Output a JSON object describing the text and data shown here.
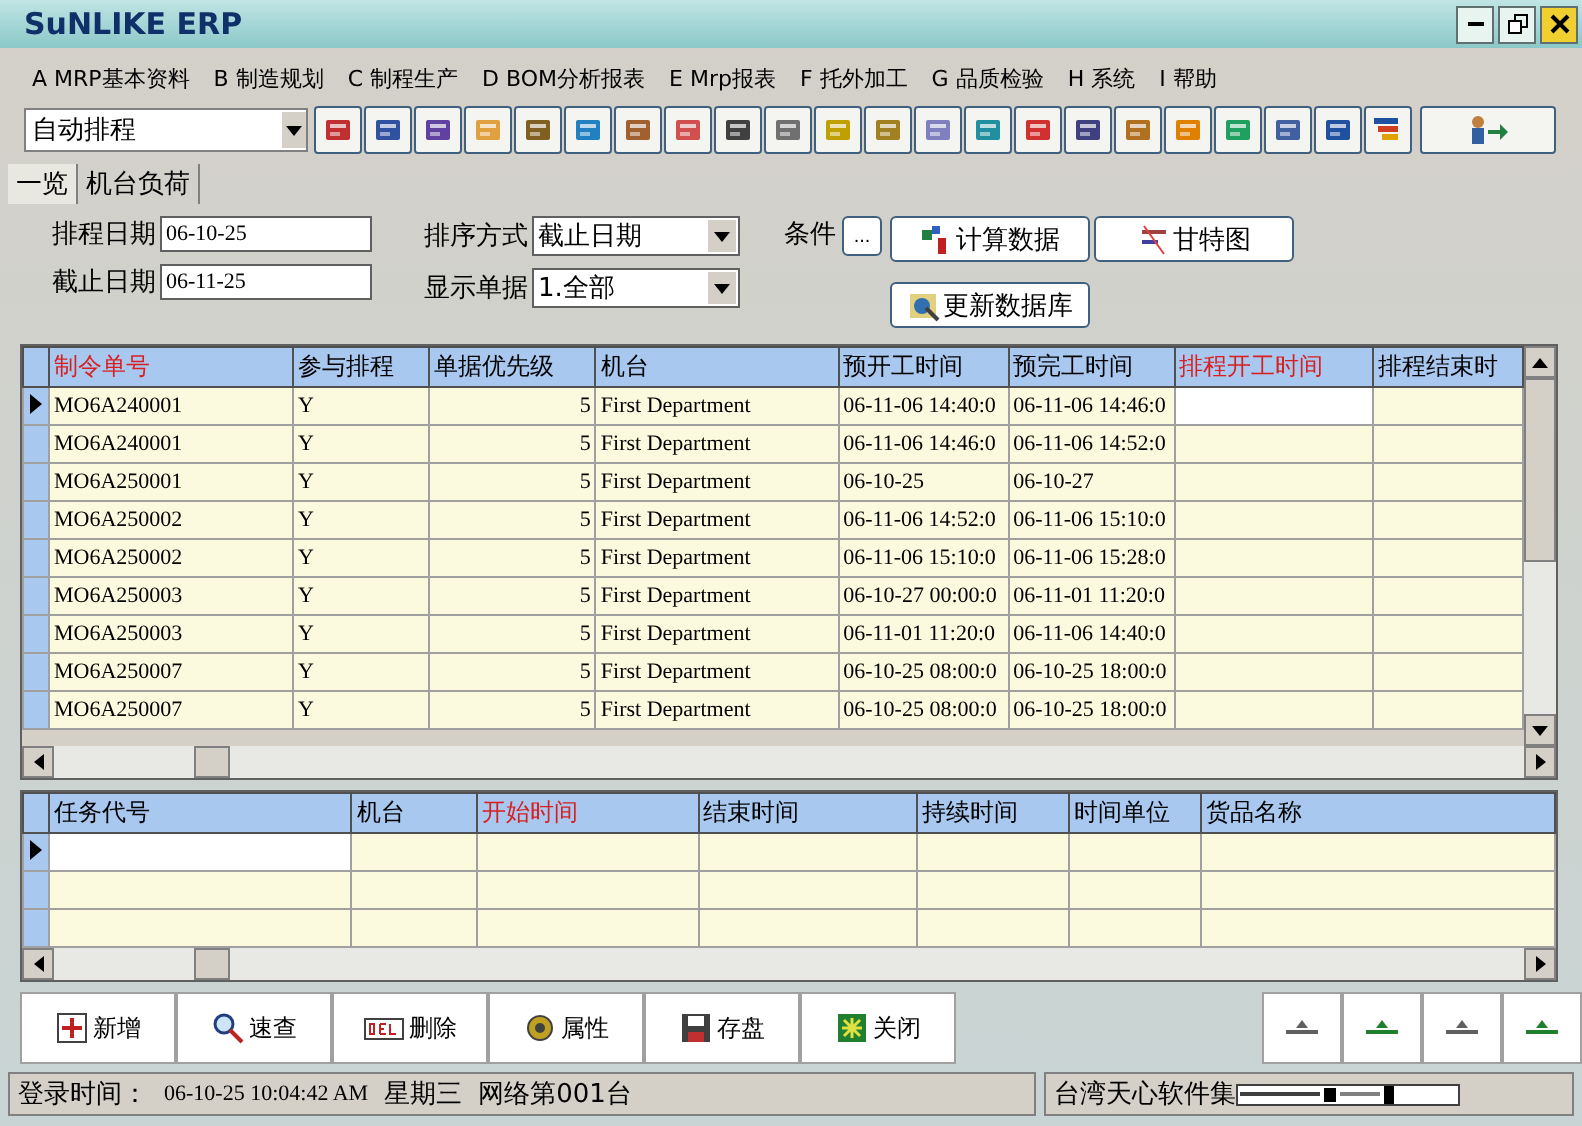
{
  "window": {
    "title": "SuNLIKE ERP"
  },
  "menu": [
    "A MRP基本资料",
    "B 制造规划",
    "C 制程生产",
    "D BOM分析报表",
    "E Mrp报表",
    "F 托外加工",
    "G 品质检验",
    "H 系统",
    "I 帮助"
  ],
  "toolbar": {
    "combo": "自动排程"
  },
  "tabs": [
    {
      "label": "一览",
      "selected": true
    },
    {
      "label": "机台负荷",
      "selected": false
    }
  ],
  "form": {
    "fields": [
      {
        "label": "排程日期",
        "value": "06-10-25"
      },
      {
        "label": "截止日期",
        "value": "06-11-25"
      }
    ],
    "selects": [
      {
        "label": "排序方式",
        "value": "截止日期"
      },
      {
        "label": "显示单据",
        "value": "1.全部"
      }
    ],
    "condition": {
      "label": "条件",
      "button": "..."
    },
    "buttons": [
      "计算数据",
      "甘特图",
      "更新数据库"
    ]
  },
  "orders": {
    "columns": [
      {
        "label": "制令单号",
        "required": true
      },
      {
        "label": "参与排程",
        "required": false
      },
      {
        "label": "单据优先级",
        "required": false
      },
      {
        "label": "机台",
        "required": false
      },
      {
        "label": "预开工时间",
        "required": false
      },
      {
        "label": "预完工时间",
        "required": false
      },
      {
        "label": "排程开工时间",
        "required": true
      },
      {
        "label": "排程结束时",
        "required": false
      }
    ],
    "rows": [
      {
        "selected": true,
        "cells": [
          "MO6A240001",
          "Y",
          "5",
          "First Department",
          "06-11-06 14:40:0",
          "06-11-06 14:46:0"
        ]
      },
      {
        "selected": false,
        "cells": [
          "MO6A240001",
          "Y",
          "5",
          "First Department",
          "06-11-06 14:46:0",
          "06-11-06 14:52:0"
        ]
      },
      {
        "selected": false,
        "cells": [
          "MO6A250001",
          "Y",
          "5",
          "First Department",
          "06-10-25",
          "06-10-27"
        ]
      },
      {
        "selected": false,
        "cells": [
          "MO6A250002",
          "Y",
          "5",
          "First Department",
          "06-11-06 14:52:0",
          "06-11-06 15:10:0"
        ]
      },
      {
        "selected": false,
        "cells": [
          "MO6A250002",
          "Y",
          "5",
          "First Department",
          "06-11-06 15:10:0",
          "06-11-06 15:28:0"
        ]
      },
      {
        "selected": false,
        "cells": [
          "MO6A250003",
          "Y",
          "5",
          "First Department",
          "06-10-27 00:00:0",
          "06-11-01 11:20:0"
        ]
      },
      {
        "selected": false,
        "cells": [
          "MO6A250003",
          "Y",
          "5",
          "First Department",
          "06-11-01 11:20:0",
          "06-11-06 14:40:0"
        ]
      },
      {
        "selected": false,
        "cells": [
          "MO6A250007",
          "Y",
          "5",
          "First Department",
          "06-10-25 08:00:0",
          "06-10-25 18:00:0"
        ]
      },
      {
        "selected": false,
        "cells": [
          "MO6A250007",
          "Y",
          "5",
          "First Department",
          "06-10-25 08:00:0",
          "06-10-25 18:00:0"
        ]
      }
    ]
  },
  "tasks": {
    "columns": [
      {
        "label": "任务代号",
        "required": false
      },
      {
        "label": "机台",
        "required": false
      },
      {
        "label": "开始时间",
        "required": true
      },
      {
        "label": "结束时间",
        "required": false
      },
      {
        "label": "持续时间",
        "required": false
      },
      {
        "label": "时间单位",
        "required": false
      },
      {
        "label": "货品名称",
        "required": false
      }
    ],
    "rows": [
      {
        "selected": true
      },
      {
        "selected": false
      },
      {
        "selected": false
      }
    ]
  },
  "actions": [
    {
      "label": "新增",
      "kind": "add"
    },
    {
      "label": "速查",
      "kind": "search"
    },
    {
      "label": "删除",
      "kind": "delete"
    },
    {
      "label": "属性",
      "kind": "gear"
    },
    {
      "label": "存盘",
      "kind": "save"
    },
    {
      "label": "关闭",
      "kind": "close"
    }
  ],
  "status_bar": {
    "login_label": "登录时间：",
    "login_time": "06-10-25 10:04:42 AM",
    "weekday": "星期三",
    "station": "网络第001台",
    "company": "台湾天心软件集"
  }
}
